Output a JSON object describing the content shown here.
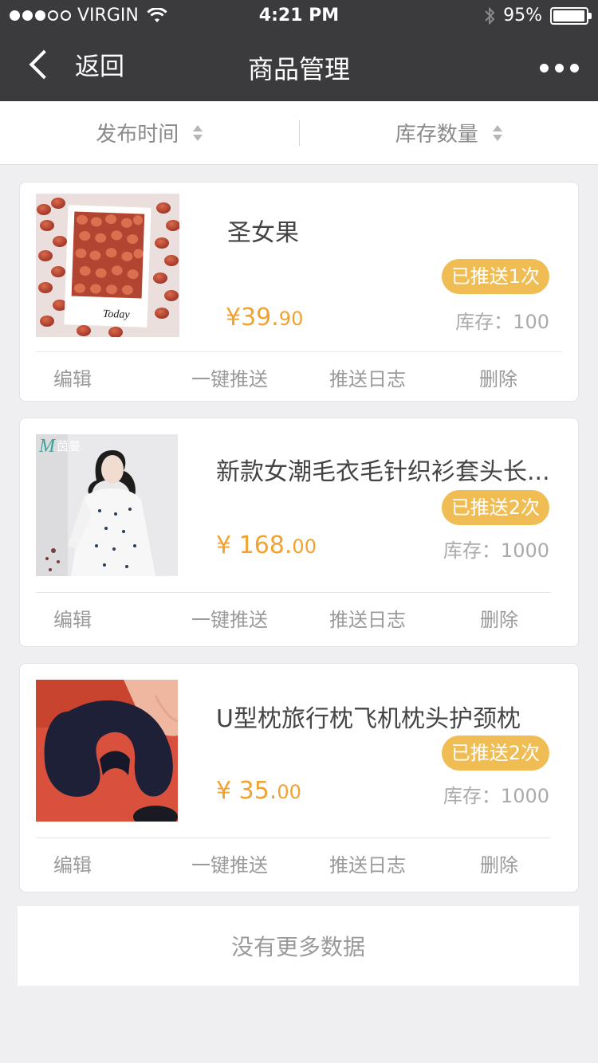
{
  "status_bar": {
    "carrier": "VIRGIN",
    "time": "4:21 PM",
    "battery": "95%",
    "battery_level": 0.95
  },
  "nav": {
    "back_label": "返回",
    "title": "商品管理"
  },
  "sort_bar": {
    "publish_time": "发布时间",
    "stock_quantity": "库存数量"
  },
  "products": [
    {
      "name": "圣女果",
      "badge": "已推送1次",
      "price_int": "¥39.",
      "price_dec": "90",
      "stock": "库存：100",
      "image_caption": "Today",
      "actions": {
        "edit": "编辑",
        "push": "一键推送",
        "log": "推送日志",
        "delete": "删除"
      }
    },
    {
      "name": "新款女潮毛衣毛针织衫套头长...",
      "badge": "已推送2次",
      "price_int": "¥ 168.",
      "price_dec": "00",
      "stock": "库存：1000",
      "image_brand": "茵曼",
      "actions": {
        "edit": "编辑",
        "push": "一键推送",
        "log": "推送日志",
        "delete": "删除"
      }
    },
    {
      "name": "U型枕旅行枕飞机枕头护颈枕",
      "badge": "已推送2次",
      "price_int": "¥ 35.",
      "price_dec": "00",
      "stock": "库存：1000",
      "actions": {
        "edit": "编辑",
        "push": "一键推送",
        "log": "推送日志",
        "delete": "删除"
      }
    }
  ],
  "footer": {
    "no_more": "没有更多数据"
  },
  "colors": {
    "nav_bg": "#3b3b3d",
    "accent_price": "#f3a12f",
    "badge_bg": "#f0bd55"
  }
}
